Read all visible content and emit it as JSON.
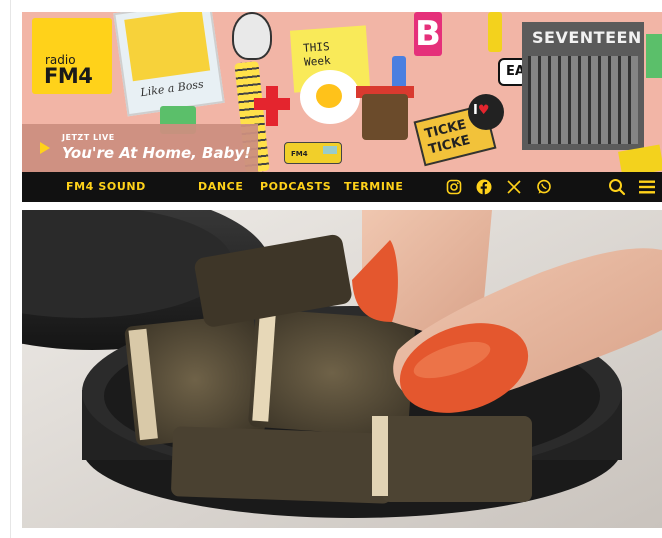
{
  "logo": {
    "small": "radio",
    "big": "FM4"
  },
  "live": {
    "label": "JETZT LIVE",
    "title": "You're At Home, Baby!"
  },
  "stickers": {
    "polaroid_caption": "Like a Boss",
    "postit_text": "THIS\nWeek",
    "letter": "B",
    "ear_text": "EA",
    "tickets_text": "TICKE\nTICKE",
    "heart_badge": "I",
    "seventeen": "SEVENTEEN",
    "van_text": "FM4"
  },
  "nav": {
    "items": [
      "FM4 SOUND",
      "DANCE",
      "PODCASTS",
      "TERMINE"
    ],
    "social": [
      "instagram-icon",
      "facebook-icon",
      "x-icon",
      "whatsapp-icon"
    ],
    "search_icon": "search-icon",
    "menu_icon": "hamburger-menu-icon"
  },
  "colors": {
    "brand_yellow": "#ffd21a",
    "banner_bg": "#f2b5a6",
    "nav_bg": "#111111"
  },
  "article": {
    "image_subject": "snus-pouches-tin-photo"
  }
}
